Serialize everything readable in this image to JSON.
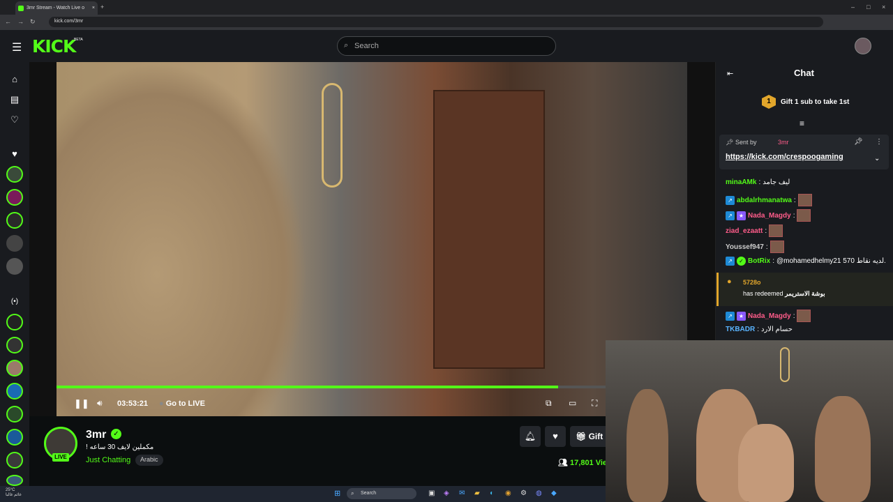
{
  "browser": {
    "tab_title": "3mr Stream - Watch Live o",
    "tab_close": "×",
    "new_tab": "+",
    "url": "kick.com/3mr"
  },
  "header": {
    "logo": "KICK",
    "beta": "BETA",
    "search_placeholder": "Search"
  },
  "player": {
    "time": "03:53:21",
    "go_live": "Go to LIVE",
    "progress_fraction": 0.914
  },
  "stream": {
    "streamer_name": "3mr",
    "live_badge": "LIVE",
    "title": "! مكملين لايف 30 ساعه",
    "category": "Just Chatting",
    "language": "Arabic",
    "gift_label": "Gift S",
    "viewers": "17,801 Vie"
  },
  "chat": {
    "title": "Chat",
    "gift_rank_number": "1",
    "gift_rank_text": "Gift 1 sub to take 1st",
    "pinned": {
      "sent_by": "Sent by",
      "sender": "3mr",
      "link": "https://kick.com/crespoogaming"
    },
    "messages": [
      {
        "user": "minaAMk",
        "color": "#53fc18",
        "text": "ليف جامد"
      },
      {
        "user": "abdalrhmanatwa",
        "color": "#53fc18",
        "text": ""
      },
      {
        "user": "Nada_Magdy",
        "color": "#ff5c8a",
        "text": ""
      },
      {
        "user": "ziad_ezaatt",
        "color": "#ff5c8a",
        "text": ""
      },
      {
        "user": "Youssef947",
        "color": "#cccccc",
        "text": ""
      },
      {
        "user": "BotRix",
        "color": "#53fc18",
        "text": "@mohamedhelmy21 570 لديه نقاط."
      }
    ],
    "redeem": {
      "user": "5728o",
      "text": "has redeemed",
      "reward": "بوشة الاستريمر"
    },
    "messages2": [
      {
        "user": "Nada_Magdy",
        "color": "#ff5c8a",
        "text": ""
      },
      {
        "user": "TKBADR",
        "color": "#5ab4ff",
        "text": "حسام الارد"
      }
    ]
  },
  "taskbar": {
    "search": "Search",
    "temp": "25°C",
    "weather_text": "غائم غالبا"
  }
}
